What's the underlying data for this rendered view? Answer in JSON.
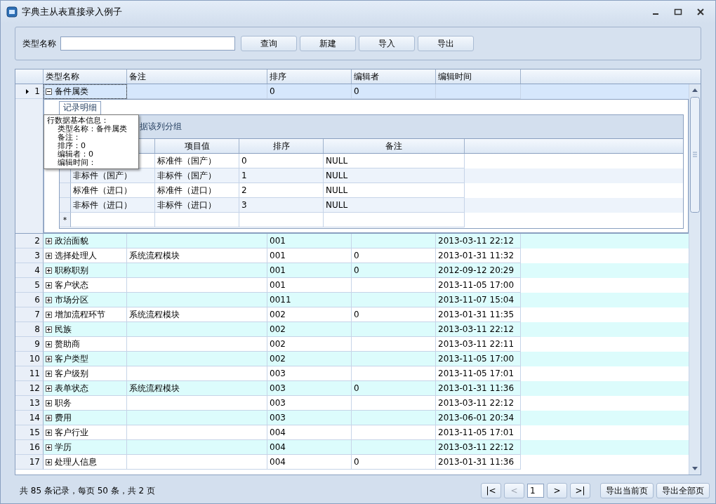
{
  "window": {
    "title": "字典主从表直接录入例子"
  },
  "search": {
    "label": "类型名称",
    "buttons": [
      "查询",
      "新建",
      "导入",
      "导出"
    ]
  },
  "grid": {
    "columns": [
      "类型名称",
      "备注",
      "排序",
      "编辑者",
      "编辑时间"
    ],
    "rows": [
      {
        "number": "1",
        "name": "备件属类",
        "sort": "0",
        "editor": "0",
        "selected": true,
        "expanded": true
      },
      {
        "number": "2",
        "name": "政治面貌",
        "sort": "001",
        "time": "2013-03-11 22:12",
        "selected": false,
        "expanded": false
      },
      {
        "number": "3",
        "name": "选择处理人",
        "note": "系统流程模块",
        "sort": "001",
        "editor": "0",
        "time": "2013-01-31 11:32",
        "selected": false,
        "expanded": false
      },
      {
        "number": "4",
        "name": "职称职别",
        "sort": "001",
        "editor": "0",
        "time": "2012-09-12 20:29",
        "selected": false,
        "expanded": false
      },
      {
        "number": "5",
        "name": "客户状态",
        "sort": "001",
        "time": "2013-11-05 17:00",
        "selected": false,
        "expanded": false
      },
      {
        "number": "6",
        "name": "市场分区",
        "sort": "0011",
        "time": "2013-11-07 15:04",
        "selected": false,
        "expanded": false
      },
      {
        "number": "7",
        "name": "增加流程环节",
        "note": "系统流程模块",
        "sort": "002",
        "editor": "0",
        "time": "2013-01-31 11:35",
        "selected": false,
        "expanded": false
      },
      {
        "number": "8",
        "name": "民族",
        "sort": "002",
        "time": "2013-03-11 22:12",
        "selected": false,
        "expanded": false
      },
      {
        "number": "9",
        "name": "赘助商",
        "sort": "002",
        "time": "2013-03-11 22:11",
        "selected": false,
        "expanded": false
      },
      {
        "number": "10",
        "name": "客户类型",
        "sort": "002",
        "time": "2013-11-05 17:00",
        "selected": false,
        "expanded": false
      },
      {
        "number": "11",
        "name": "客户级别",
        "sort": "003",
        "time": "2013-11-05 17:01",
        "selected": false,
        "expanded": false
      },
      {
        "number": "12",
        "name": "表单状态",
        "note": "系统流程模块",
        "sort": "003",
        "editor": "0",
        "time": "2013-01-31 11:36",
        "selected": false,
        "expanded": false
      },
      {
        "number": "13",
        "name": "职务",
        "sort": "003",
        "time": "2013-03-11 22:12",
        "selected": false,
        "expanded": false
      },
      {
        "number": "14",
        "name": "费用",
        "sort": "003",
        "time": "2013-06-01 20:34",
        "selected": false,
        "expanded": false
      },
      {
        "number": "15",
        "name": "客户行业",
        "sort": "004",
        "time": "2013-11-05 17:01",
        "selected": false,
        "expanded": false
      },
      {
        "number": "16",
        "name": "学历",
        "sort": "004",
        "time": "2013-03-11 22:12",
        "selected": false,
        "expanded": false
      },
      {
        "number": "17",
        "name": "处理人信息",
        "sort": "004",
        "editor": "0",
        "time": "2013-01-31 11:36",
        "selected": false,
        "expanded": false
      }
    ]
  },
  "detail": {
    "tab": "记录明细",
    "group_hint": "据该列分组",
    "columns": [
      "项目值",
      "排序",
      "备注"
    ],
    "rows": [
      {
        "value": "标准件（国产）",
        "sort": "0",
        "note": "NULL"
      },
      {
        "name": "非标件（国产）",
        "value": "非标件（国产）",
        "sort": "1",
        "note": "NULL"
      },
      {
        "name": "标准件（进口）",
        "value": "标准件（进口）",
        "sort": "2",
        "note": "NULL"
      },
      {
        "name": "非标件（进口）",
        "value": "非标件（进口）",
        "sort": "3",
        "note": "NULL"
      }
    ],
    "new_row_mark": "*"
  },
  "tooltip": {
    "title": "行数据基本信息：",
    "lines": [
      "类型名称：备件属类",
      "备注：",
      "排序：0",
      "编辑者：0",
      "编辑时间："
    ]
  },
  "footer": {
    "summary": "共 85 条记录，每页 50 条，共 2 页",
    "pager": [
      {
        "label": "|<",
        "disabled": false
      },
      {
        "label": "<",
        "disabled": true
      }
    ],
    "page": "1",
    "pager_next": [
      {
        "label": ">",
        "disabled": false
      },
      {
        "label": ">|",
        "disabled": false
      }
    ],
    "exports": [
      "导出当前页",
      "导出全部页"
    ]
  }
}
